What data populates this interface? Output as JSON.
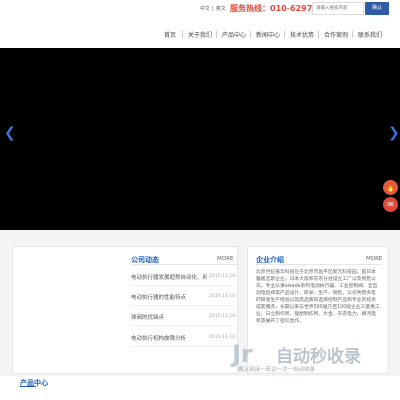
{
  "header": {
    "lang_cn": "中文",
    "lang_sep": "|",
    "lang_en": "英文",
    "hotline": "服务热线：010-62976781",
    "search_placeholder": "请输入搜索内容",
    "search_button": "确认"
  },
  "nav": {
    "items": [
      "首页",
      "关于我们",
      "产品中心",
      "新闻中心",
      "技术优势",
      "合作案例",
      "联系我们"
    ]
  },
  "banner": {
    "prev": "❮",
    "next": "❯"
  },
  "float_buttons": {
    "fire": "🔥",
    "chat": "✉"
  },
  "news": {
    "title": "公司动态",
    "more": "MORE",
    "rows": [
      {
        "text": "电动执行器发展趋势自动化、网...",
        "date": "2015-11-18"
      },
      {
        "text": "电动执行器的性能特点",
        "date": "2015-11-18"
      },
      {
        "text": "球阀的优缺点",
        "date": "2015-11-18"
      },
      {
        "text": "电动执行机构故障分析",
        "date": "2015-11-18"
      }
    ]
  },
  "intro": {
    "title": "企业介绍",
    "more": "MORE",
    "body": "北京世纪嘉华科技位于北京市昌平区新元科技园，是日本雅路瓦斯企业、日本大阪和东京分驻设立工厂以及销售公司，专业从事awade系列电动执行器、工业控制阀、全自动电控阀等产品设计、研发、生产、销售。公司凭借多年的研发生产经验以及高品质的选择控制产品和专业的技术成套服务，长期以来与世界500强乃至100强企业三菱重工业、日立制作所、理想制作所、大金、东京电力、横河电机等展开了密切合作。"
  },
  "products": {
    "title": "产品中心"
  },
  "watermark": {
    "logo": "Jr",
    "text": "自动秒收录",
    "sub": "做上链接一来访一次一自动收录"
  },
  "colors": {
    "accent": "#1a5bbf",
    "hotline": "#e04a3a",
    "search_button": "#2f5aa8",
    "float_fire": "#e45a3c",
    "float_chat": "#e04a3a"
  }
}
